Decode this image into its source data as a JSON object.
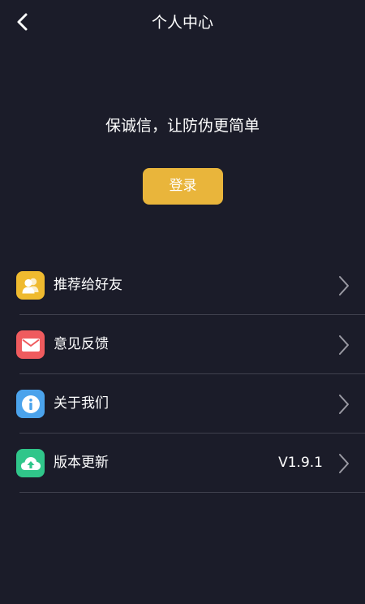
{
  "header": {
    "title": "个人中心",
    "back_icon": "chevron-left-icon"
  },
  "hero": {
    "slogan": "保诚信，让防伪更简单",
    "login_label": "登录"
  },
  "menu": {
    "items": [
      {
        "label": "推荐给好友",
        "icon": "users-icon",
        "color": "#efba2f",
        "value": ""
      },
      {
        "label": "意见反馈",
        "icon": "mail-icon",
        "color": "#ef5b5e",
        "value": ""
      },
      {
        "label": "关于我们",
        "icon": "info-icon",
        "color": "#4ba3ec",
        "value": ""
      },
      {
        "label": "版本更新",
        "icon": "cloud-upload-icon",
        "color": "#30c68a",
        "value": "V1.9.1"
      }
    ]
  },
  "colors": {
    "background": "#1b1c29",
    "accent": "#e9b53b",
    "divider": "#3f404d"
  }
}
